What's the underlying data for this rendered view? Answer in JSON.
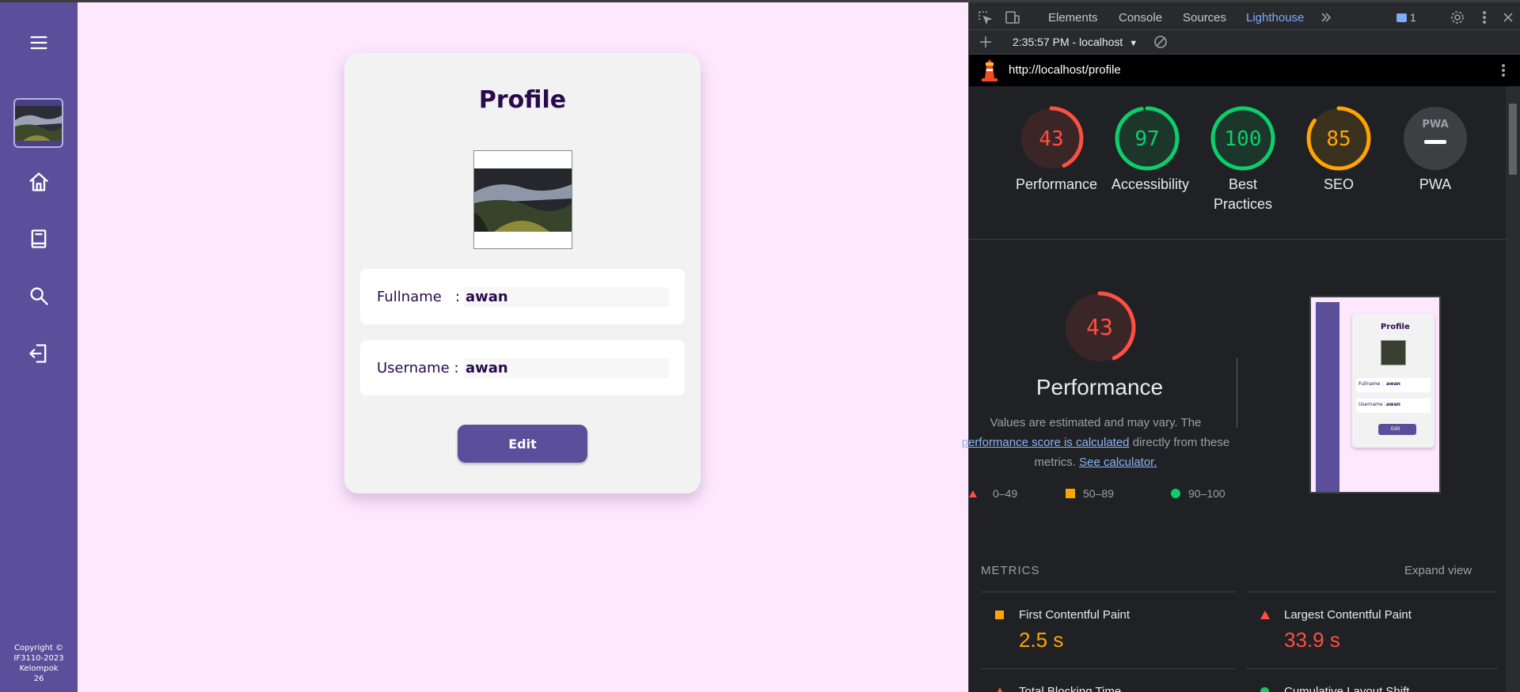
{
  "app": {
    "card_title": "Profile",
    "fields": [
      {
        "label": "Fullname   :",
        "value": "awan"
      },
      {
        "label": "Username :",
        "value": "awan"
      }
    ],
    "edit_label": "Edit",
    "copyright": [
      "Copyright ©",
      "IF3110-2023",
      "Kelompok",
      "26"
    ]
  },
  "devtools": {
    "tabs": [
      "Elements",
      "Console",
      "Sources",
      "Lighthouse"
    ],
    "active_tab": "Lighthouse",
    "issues_count": "1",
    "report": "2:35:57 PM - localhost",
    "url": "http://localhost/profile",
    "scores": [
      {
        "name": "Performance",
        "score": "43",
        "value": 43,
        "color": "#ff4e42"
      },
      {
        "name": "Accessibility",
        "score": "97",
        "value": 97,
        "color": "#0cce6b"
      },
      {
        "name": "Best Practices",
        "score": "100",
        "value": 100,
        "color": "#0cce6b"
      },
      {
        "name": "SEO",
        "score": "85",
        "value": 85,
        "color": "#ffa400"
      },
      {
        "name": "PWA",
        "score": "",
        "value": 0,
        "color": "#9aa0a6"
      }
    ],
    "pwa_badge": "PWA",
    "perf_detail": {
      "score": "43",
      "value": 43,
      "title": "Performance",
      "desc_1": "Values are estimated and may vary. The",
      "desc_link_1": "performance score is calculated",
      "desc_2": "directly from these metrics.",
      "desc_link_2": "See calculator."
    },
    "legend": [
      "0–49",
      "50–89",
      "90–100"
    ],
    "thumb": {
      "title": "Profile",
      "fullname": "Fullname   :",
      "username": "Username :",
      "value": "awan",
      "edit": "Edit"
    },
    "metrics_title": "METRICS",
    "expand_view": "Expand view",
    "metrics": [
      {
        "name": "First Contentful Paint",
        "value": "2.5 s",
        "color": "#ffa400",
        "indicator": "square"
      },
      {
        "name": "Largest Contentful Paint",
        "value": "33.9 s",
        "color": "#ff4e42",
        "indicator": "triangle"
      },
      {
        "name": "Total Blocking Time",
        "value": "",
        "color": "#ff4e42",
        "indicator": "triangle"
      },
      {
        "name": "Cumulative Layout Shift",
        "value": "",
        "color": "#0cce6b",
        "indicator": "circle"
      }
    ],
    "colors": {
      "fail": "#ff4e42",
      "average": "#ffa400",
      "pass": "#0cce6b",
      "link": "#8ab4f8"
    }
  }
}
